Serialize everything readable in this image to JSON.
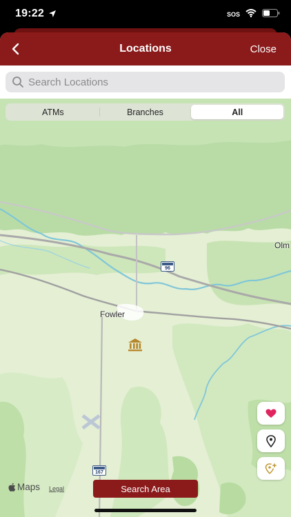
{
  "status_bar": {
    "time": "19:22",
    "sos": "SOS"
  },
  "nav": {
    "title": "Locations",
    "close_label": "Close"
  },
  "search": {
    "placeholder": "Search Locations",
    "value": ""
  },
  "filter": {
    "options": [
      "ATMs",
      "Branches",
      "All"
    ],
    "selected": "All"
  },
  "map": {
    "labels": {
      "town": "Fowler",
      "edge_town": "Olm"
    },
    "route_shields": [
      "96",
      "167"
    ]
  },
  "buttons": {
    "search_area": "Search Area"
  },
  "attribution": {
    "maps": "Maps",
    "legal": "Legal"
  },
  "colors": {
    "brand": "#8b1a1a",
    "favorite": "#e0245e",
    "bank_pin": "#b8862b"
  }
}
